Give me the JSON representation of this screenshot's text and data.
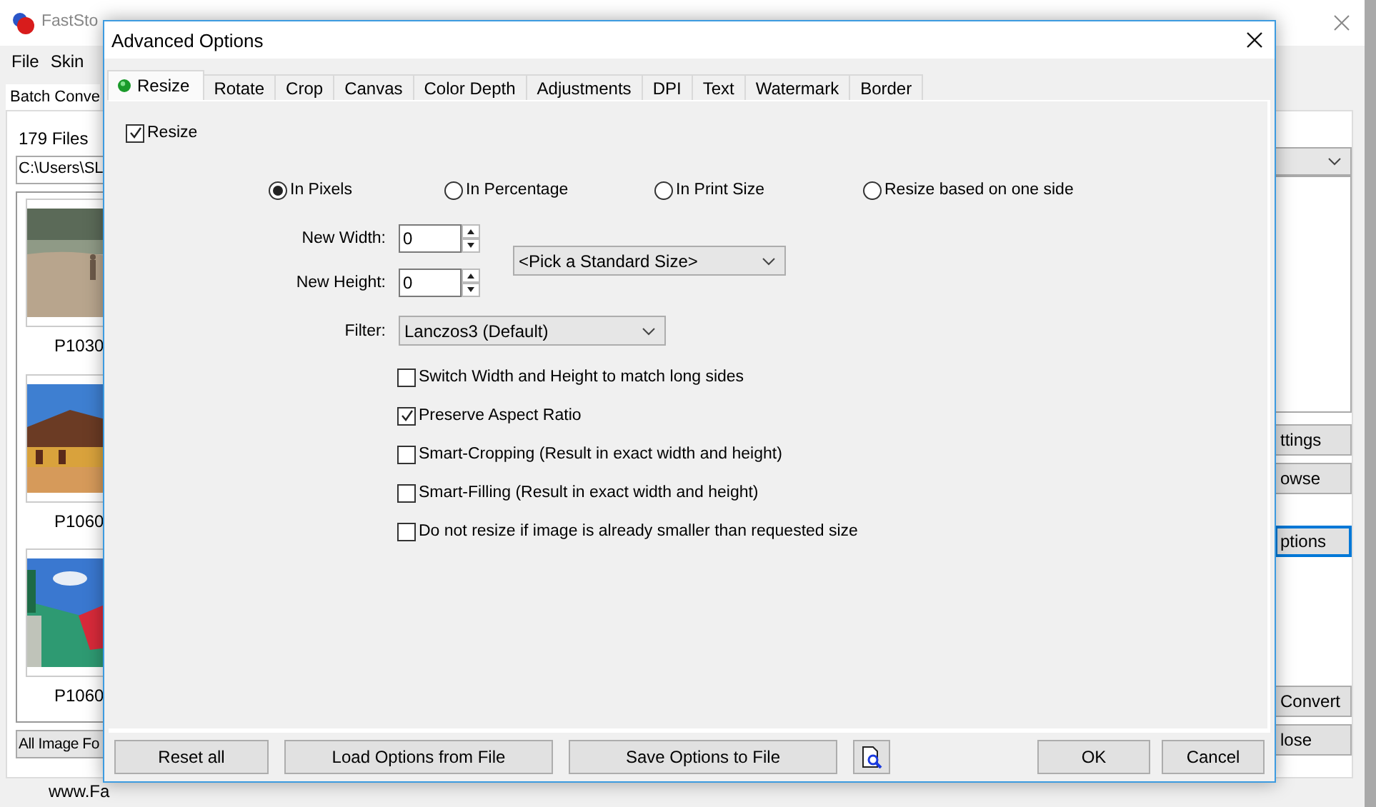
{
  "app_window": {
    "title": "FastSto",
    "menu": [
      "File",
      "Skin"
    ],
    "tab": "Batch Conve",
    "file_count": "179 Files",
    "folder_path": "C:\\Users\\SL",
    "thumbnails": [
      {
        "label": "P1030"
      },
      {
        "label": "P1060"
      },
      {
        "label": "P1060"
      }
    ],
    "file_type_filter": "All Image Fo",
    "website": "www.Fa",
    "side_buttons": [
      {
        "label": "ttings",
        "focused": false
      },
      {
        "label": "owse",
        "focused": false
      },
      {
        "label": "ptions",
        "focused": true
      },
      {
        "label": "Convert",
        "focused": false
      },
      {
        "label": "lose",
        "focused": false
      }
    ]
  },
  "dialog": {
    "title": "Advanced Options",
    "tabs": [
      {
        "label": "Resize",
        "selected": true,
        "marked": true
      },
      {
        "label": "Rotate",
        "selected": false,
        "marked": false
      },
      {
        "label": "Crop",
        "selected": false,
        "marked": false
      },
      {
        "label": "Canvas",
        "selected": false,
        "marked": false
      },
      {
        "label": "Color Depth",
        "selected": false,
        "marked": false
      },
      {
        "label": "Adjustments",
        "selected": false,
        "marked": false
      },
      {
        "label": "DPI",
        "selected": false,
        "marked": false
      },
      {
        "label": "Text",
        "selected": false,
        "marked": false
      },
      {
        "label": "Watermark",
        "selected": false,
        "marked": false
      },
      {
        "label": "Border",
        "selected": false,
        "marked": false
      }
    ],
    "resize_enabled": {
      "label": "Resize",
      "checked": true
    },
    "size_modes": [
      {
        "label": "In Pixels",
        "selected": true
      },
      {
        "label": "In Percentage",
        "selected": false
      },
      {
        "label": "In Print Size",
        "selected": false
      },
      {
        "label": "Resize based on one side",
        "selected": false
      }
    ],
    "new_width": {
      "label": "New Width:",
      "value": "0"
    },
    "new_height": {
      "label": "New Height:",
      "value": "0"
    },
    "standard_size": {
      "value": "<Pick a Standard Size>"
    },
    "filter": {
      "label": "Filter:",
      "value": "Lanczos3 (Default)"
    },
    "options": [
      {
        "label": "Switch Width and Height to match long sides",
        "checked": false
      },
      {
        "label": "Preserve Aspect Ratio",
        "checked": true
      },
      {
        "label": "Smart-Cropping (Result in exact width and height)",
        "checked": false
      },
      {
        "label": "Smart-Filling (Result in exact width and height)",
        "checked": false
      },
      {
        "label": "Do not resize if image is already smaller than requested size",
        "checked": false
      }
    ],
    "file_buttons": [
      "Reset all",
      "Load Options from File",
      "Save Options to File"
    ],
    "confirm_buttons": [
      "OK",
      "Cancel"
    ]
  }
}
